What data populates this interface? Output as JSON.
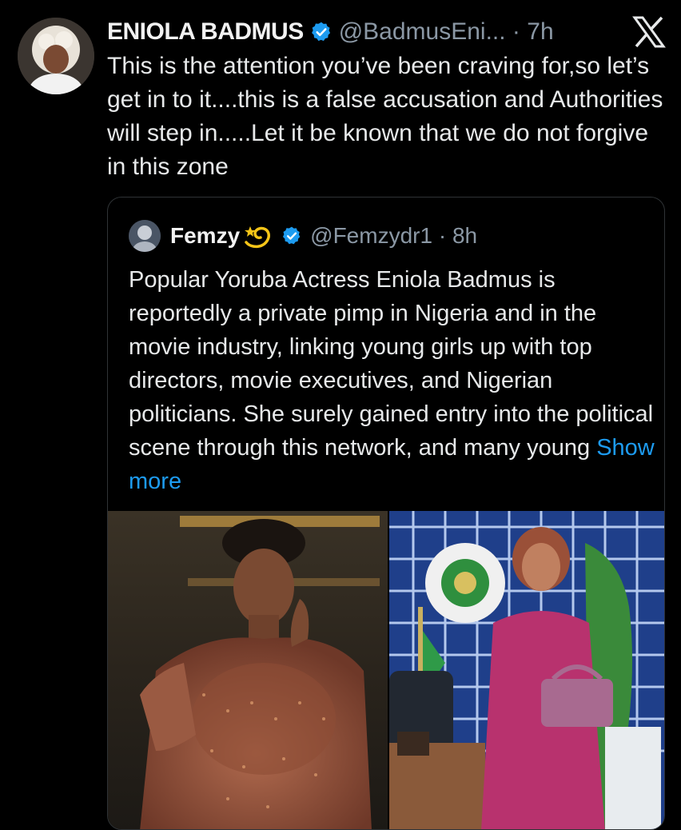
{
  "tweet": {
    "author_name": "ENIOLA BADMUS",
    "author_handle": "@BadmusEni...",
    "time": "7h",
    "text": "This is the attention you’ve been craving for,so let’s get in to it....this is a false accusation and Authorities will step in.....Let it be known that we do not forgive in this zone",
    "avatar_icon": "profile-photo",
    "verified_icon": "verified-badge-icon",
    "close_icon": "x-logo-icon"
  },
  "quoted": {
    "author_name": "Femzy",
    "author_emoji": "dizzy-emoji",
    "author_handle": "@Femzydr1",
    "time": "8h",
    "text": "Popular Yoruba Actress Eniola Badmus is reportedly a private pimp in Nigeria and in the movie industry, linking young girls up with top directors, movie executives, and Nigerian politicians. She surely gained entry into the political scene through this network, and many young",
    "show_more": "Show more",
    "media": [
      {
        "name": "photo-woman-embellished-gown"
      },
      {
        "name": "photo-woman-magenta-dress-office"
      }
    ]
  },
  "colors": {
    "background": "#000000",
    "text": "#e7e9ea",
    "muted": "#8b98a5",
    "link": "#1d9bf0",
    "verified": "#1d9bf0",
    "border": "#2f3336"
  }
}
